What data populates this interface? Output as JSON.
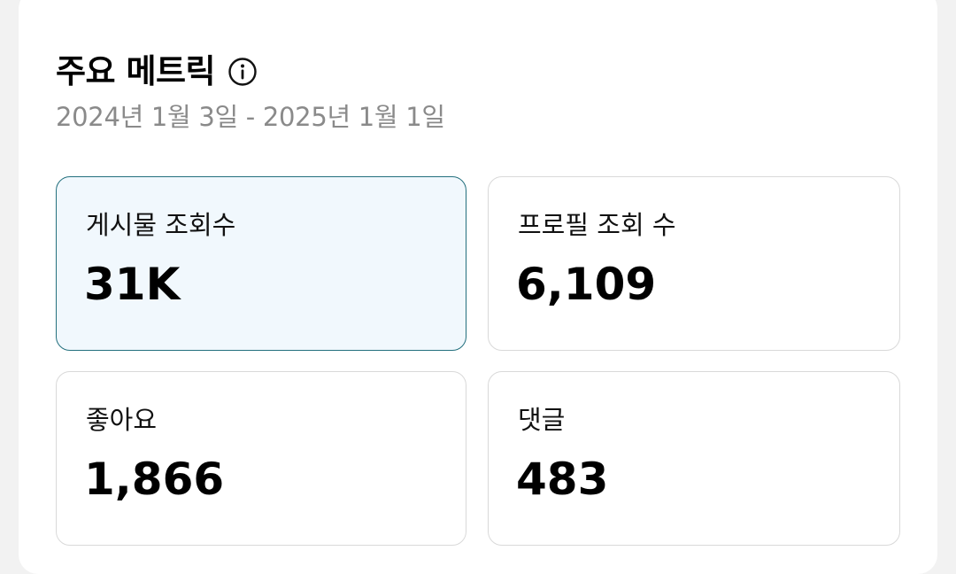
{
  "header": {
    "title": "주요 메트릭",
    "info_icon": "info-circle-icon",
    "date_range": "2024년 1월 3일 - 2025년 1월 1일"
  },
  "metrics": [
    {
      "label": "게시물 조회수",
      "value": "31K",
      "selected": true
    },
    {
      "label": "프로필 조회 수",
      "value": "6,109",
      "selected": false
    },
    {
      "label": "좋아요",
      "value": "1,866",
      "selected": false
    },
    {
      "label": "댓글",
      "value": "483",
      "selected": false
    }
  ],
  "colors": {
    "selected_card_bg": "#f1f8fd",
    "selected_card_border": "#24707e",
    "card_border": "#d9d9d9",
    "subtitle": "#8a8a8a",
    "page_bg": "#f2f2f2"
  }
}
